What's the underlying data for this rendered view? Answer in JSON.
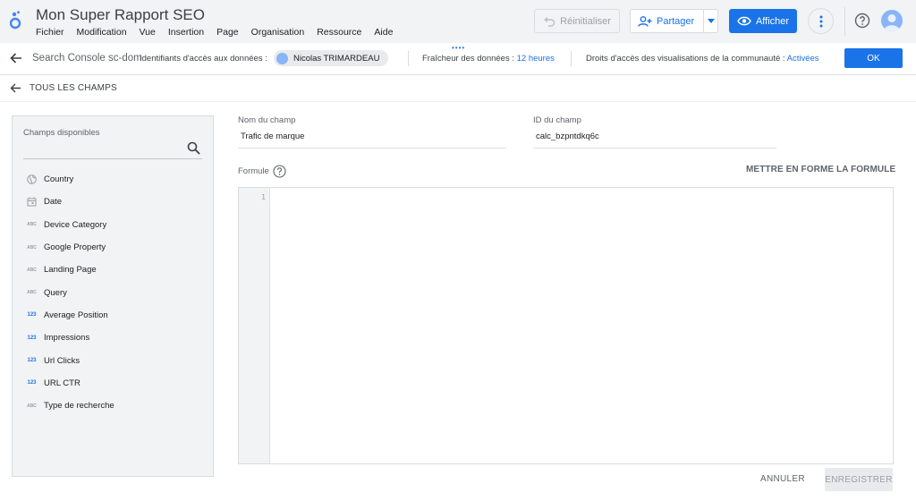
{
  "app": {
    "title": "Mon Super Rapport SEO"
  },
  "menu": [
    "Fichier",
    "Modification",
    "Vue",
    "Insertion",
    "Page",
    "Organisation",
    "Ressource",
    "Aide"
  ],
  "toolbar": {
    "reset_label": "Réinitialiser",
    "share_label": "Partager",
    "view_label": "Afficher"
  },
  "datasource": {
    "name": "Search Console sc-dom",
    "credentials_label": "Identifiants d'accès aux données :",
    "credentials_user": "Nicolas TRIMARDEAU",
    "freshness_label": "Fraîcheur des données :",
    "freshness_value": "12 heures",
    "rights_label": "Droits d'accès des visualisations de la communauté :",
    "rights_value": "Activées",
    "ok_label": "OK"
  },
  "subheader": {
    "back_label": "TOUS LES CHAMPS"
  },
  "fields_panel": {
    "label": "Champs disponibles",
    "items": [
      {
        "label": "Country",
        "icon": "globe-icon"
      },
      {
        "label": "Date",
        "icon": "calendar-icon"
      },
      {
        "label": "Device Category",
        "icon": "text-type-icon"
      },
      {
        "label": "Google Property",
        "icon": "text-type-icon"
      },
      {
        "label": "Landing Page",
        "icon": "text-type-icon"
      },
      {
        "label": "Query",
        "icon": "text-type-icon"
      },
      {
        "label": "Average Position",
        "icon": "number-type-icon"
      },
      {
        "label": "Impressions",
        "icon": "number-type-icon"
      },
      {
        "label": "Url Clicks",
        "icon": "number-type-icon"
      },
      {
        "label": "URL CTR",
        "icon": "number-type-icon"
      },
      {
        "label": "Type de recherche",
        "icon": "text-type-icon"
      }
    ],
    "text_type_glyph": "ABC",
    "number_type_glyph": "123"
  },
  "form": {
    "name_label": "Nom du champ",
    "name_value": "Trafic de marque",
    "id_label": "ID du champ",
    "id_value": "calc_bzpntdkq6c",
    "formula_label": "Formule",
    "format_label": "METTRE EN FORME LA FORMULE",
    "line_number": "1",
    "cancel_label": "ANNULER",
    "save_label": "ENREGISTRER"
  }
}
